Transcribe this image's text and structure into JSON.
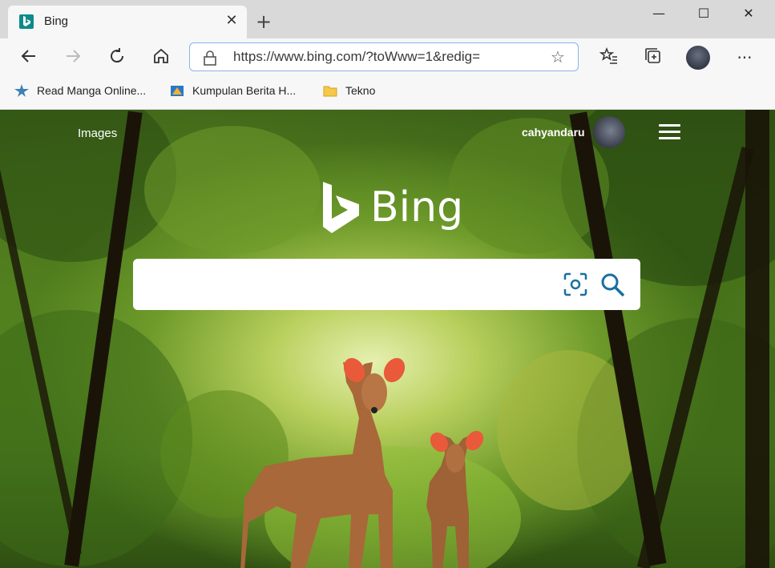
{
  "browser": {
    "tab": {
      "title": "Bing"
    },
    "window_controls": {
      "minimize": "—",
      "maximize": "☐",
      "close": "✕"
    },
    "address_bar": {
      "url": "https://www.bing.com/?toWww=1&redig="
    },
    "bookmarks": [
      {
        "label": "Read Manga Online..."
      },
      {
        "label": "Kumpulan Berita H..."
      },
      {
        "label": "Tekno"
      }
    ]
  },
  "page": {
    "nav": {
      "images": "Images",
      "username": "cahyandaru"
    },
    "logo_text": "Bing",
    "search": {
      "placeholder": ""
    }
  },
  "colors": {
    "bing_teal": "#0e8a8a",
    "search_icon": "#1a6fa0",
    "address_border": "#8ab3e6"
  }
}
